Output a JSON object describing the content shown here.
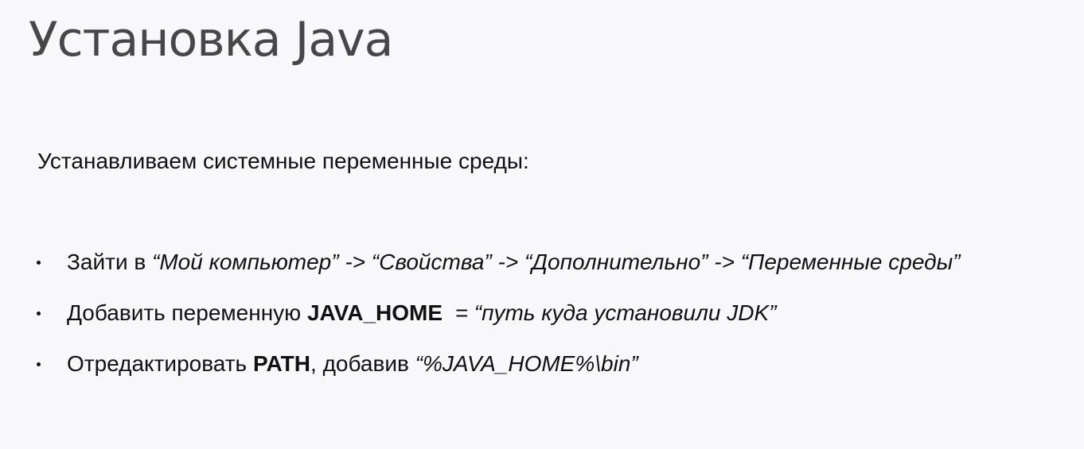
{
  "slide": {
    "title": "Установка Java",
    "intro": "Устанавливаем системные переменные среды:",
    "bullet1": {
      "lead": "Зайти в ",
      "path": "“Мой компьютер” -> “Свойства” -> “Дополнительно” -> “Переменные среды”"
    },
    "bullet2": {
      "lead": "Добавить переменную ",
      "var": "JAVA_HOME",
      "gap": "  ",
      "value": "= “путь куда установили JDK”"
    },
    "bullet3": {
      "lead": "Отредактировать ",
      "var": "PATH",
      "mid": ", добавив ",
      "value": "“%JAVA_HOME%\\bin”"
    }
  }
}
